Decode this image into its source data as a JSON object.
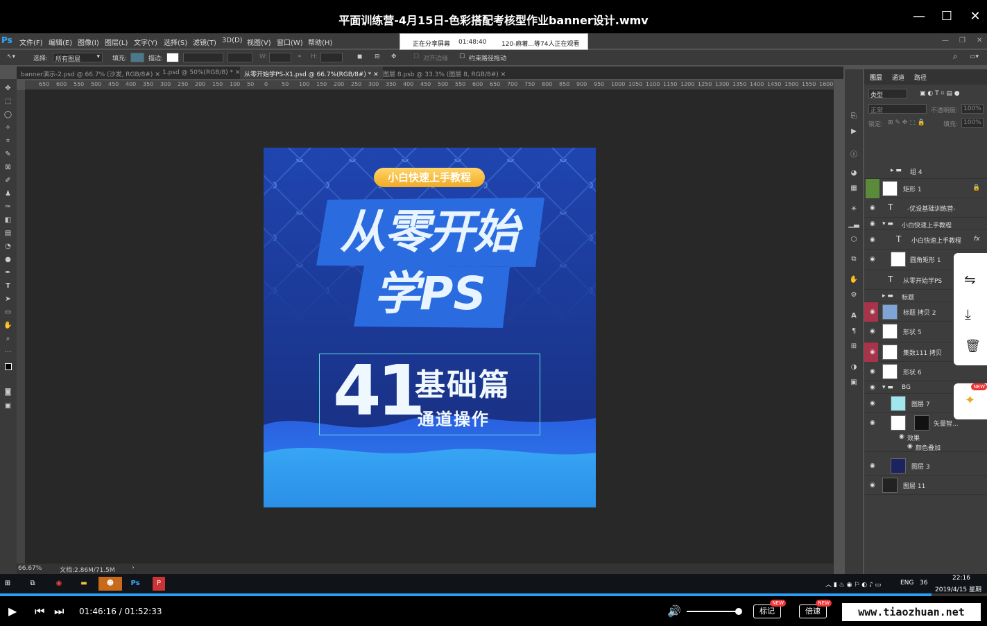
{
  "window": {
    "title": "平面训练营-4月15日-色彩搭配考核型作业banner设计.wmv"
  },
  "menu": {
    "logo": "Ps",
    "items": [
      "文件(F)",
      "编辑(E)",
      "图像(I)",
      "图层(L)",
      "文字(Y)",
      "选择(S)",
      "滤镜(T)",
      "3D(D)",
      "视图(V)",
      "窗口(W)",
      "帮助(H)"
    ]
  },
  "share": {
    "status": "正在分享屏幕",
    "time": "01:48:40",
    "viewers": "120-麻薯...等74人正在观看"
  },
  "options": {
    "select_label": "选择:",
    "select_value": "所有图层",
    "fill_label": "填充:",
    "stroke_label": "描边:",
    "w_label": "W:",
    "h_label": "H:",
    "align_edges": "对齐边缘",
    "constrain": "约束路径拖动"
  },
  "tabs": [
    "banner演示-2.psd @ 66.7% (沙发, RGB/8#)",
    "1.psd @ 50%(RGB/8) *",
    "从零开始学PS-X1.psd @ 66.7%(RGB/8#) *",
    "图层 8.psb @ 33.3% (图层 8, RGB/8#)"
  ],
  "ruler": [
    "650",
    "600",
    "550",
    "500",
    "450",
    "400",
    "350",
    "300",
    "250",
    "200",
    "150",
    "100",
    "50",
    "0",
    "50",
    "100",
    "150",
    "200",
    "250",
    "300",
    "350",
    "400",
    "450",
    "500",
    "550",
    "600",
    "650",
    "700",
    "750",
    "800",
    "850",
    "900",
    "950",
    "1000",
    "1050",
    "1100",
    "1150",
    "1200",
    "1250",
    "1300",
    "1350",
    "1400",
    "1450",
    "1500",
    "1550",
    "1600"
  ],
  "artboard": {
    "badge": "小白快速上手教程",
    "title1": "从零开始",
    "title2": "学PS",
    "number": "41",
    "subtitle": "基础篇",
    "subtitle2": "通道操作"
  },
  "status": {
    "zoom": "66.67%",
    "doc": "文档:2.86M/71.5M"
  },
  "layers_panel": {
    "tabs": [
      "图层",
      "通道",
      "路径"
    ],
    "filter": "类型",
    "blend": "正常",
    "opacity_label": "不透明度:",
    "opacity": "100%",
    "lock_label": "锁定:",
    "fill_label": "填充:",
    "fill": "100%",
    "rows": [
      {
        "name": "组 4",
        "type": "group"
      },
      {
        "name": "矩形 1",
        "type": "layer"
      },
      {
        "name": "-优设基础训练营-",
        "type": "text"
      },
      {
        "name": "小白快速上手教程",
        "type": "group"
      },
      {
        "name": "小白快速上手教程",
        "type": "text"
      },
      {
        "name": "圆角矩形 1",
        "type": "layer"
      },
      {
        "name": "从零开始学PS",
        "type": "text"
      },
      {
        "name": "标题",
        "type": "group"
      },
      {
        "name": "标题 拷贝 2",
        "type": "layer"
      },
      {
        "name": "形状 5",
        "type": "layer"
      },
      {
        "name": "集数111 拷贝",
        "type": "layer"
      },
      {
        "name": "形状 6",
        "type": "layer"
      },
      {
        "name": "BG",
        "type": "group"
      },
      {
        "name": "图层 7",
        "type": "layer"
      },
      {
        "name": "矢量智...",
        "type": "layer"
      },
      {
        "name": "效果",
        "type": "effect"
      },
      {
        "name": "颜色叠加",
        "type": "effect"
      },
      {
        "name": "图层 3",
        "type": "layer"
      },
      {
        "name": "图层 11",
        "type": "layer"
      }
    ]
  },
  "sidebar": {
    "new": "NEW"
  },
  "taskbar": {
    "lang": "ENG",
    "num": "36",
    "time": "22:16",
    "date": "2019/4/15 星期"
  },
  "player": {
    "time": "01:46:16 / 01:52:33",
    "progress": 0.944,
    "mark": "标记",
    "speed": "倍速",
    "new": "NEW",
    "watermark": "www.tiaozhuan.net"
  }
}
